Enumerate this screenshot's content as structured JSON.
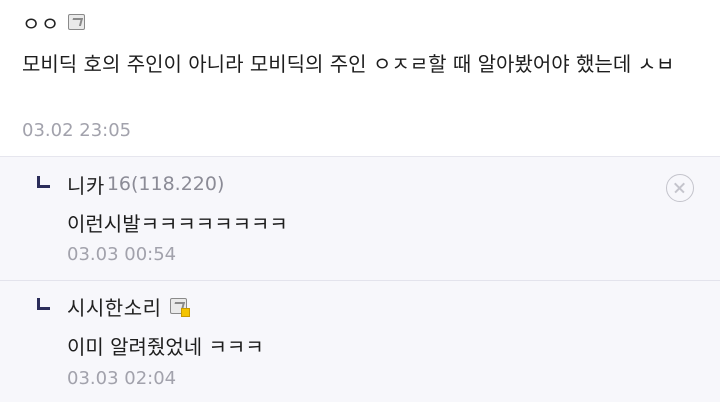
{
  "comments": [
    {
      "author": "ㅇㅇ",
      "author_icon": "fixed-nick-icon",
      "text": "모비딕 호의 주인이 아니라 모비딕의 주인 ㅇㅈㄹ할 때 알아봤어야 했는데 ㅅㅂ",
      "date": "03.02 23:05"
    }
  ],
  "replies": [
    {
      "author": "니카",
      "level": "16",
      "ip": "(118.220)",
      "text": "이런시발ㅋㅋㅋㅋㅋㅋㅋㅋ",
      "date": "03.03 00:54",
      "delete_icon": "delete-circle-icon"
    },
    {
      "author": "시시한소리",
      "author_icon": "fixed-nick-gold-icon",
      "text": "이미 알려줬었네 ㅋㅋㅋ",
      "date": "03.03 02:04"
    }
  ]
}
